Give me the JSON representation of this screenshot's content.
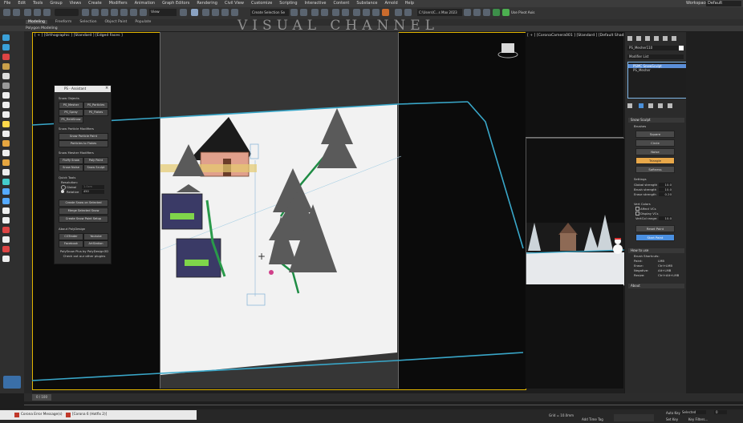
{
  "menu": [
    "File",
    "Edit",
    "Tools",
    "Group",
    "Views",
    "Create",
    "Modifiers",
    "Animation",
    "Graph Editors",
    "Rendering",
    "Civil View",
    "Customize",
    "Scripting",
    "Interactive",
    "Content",
    "Substance",
    "Arnold",
    "Help"
  ],
  "workspaces": {
    "label": "Workspaces:",
    "value": "Default"
  },
  "toolbar": {
    "view_dropdown": "View",
    "selection_set": "Create Selection Se",
    "project_path": "C:\\Users\\C...s Max 2023",
    "pivot": "Use Pivot Axis"
  },
  "ribbon_tabs": [
    "Modeling",
    "Freeform",
    "Selection",
    "Object Paint",
    "Populate"
  ],
  "subribbon": "Polygon Modeling",
  "watermark": "VISUAL CHANNEL",
  "viewports": {
    "main_label": "[ + ] [Orthographic ] [Standard ] [Edged Faces ]",
    "camera_label": "[ + ] [CoronaCamera001 ] [Standard ] [Default Shading ]"
  },
  "polysnow": {
    "title": "PS - Assistant",
    "snow_objects": "Snow Objects",
    "btn_ps_mesher": "PS_Mesher",
    "btn_ps_particles": "PS_Particles",
    "btn_ps_spray": "PS_Spray",
    "btn_ps_flakes": "PS_Flakes",
    "btn_ps_fieldsnow": "PS_FieldSnow",
    "particle_modifiers": "Snow Particle Modifiers",
    "btn_snow_particle_paint": "Snow Particle Paint",
    "btn_particles_to_flakes": "Particles to Flakes",
    "mesher_modifiers": "Snow Mesher Modifiers",
    "btn_fluffy_snow": "Fluffy Snow",
    "btn_poly_paint": "Poly Paint",
    "btn_snow_noise": "Snow Noise",
    "btn_snow_sculpt": "Snow Sculpt",
    "quick_tools": "Quick Tools",
    "resolution": "Resolution:",
    "radio_global": "Global",
    "global_value": "1.0cm",
    "radio_relative": "Relative",
    "relative_value": "450",
    "btn_create_on_selected": "Create Snow on Selected",
    "btn_merge_selected": "Merge Selected Snow",
    "btn_create_paint_setup": "Create Snow Paint Setup",
    "about": "About PolyDesign",
    "btn_cgtrader": "CGTrader",
    "btn_youtube": "Youtube",
    "btn_facebook": "Facebook",
    "btn_artstation": "ArtStation",
    "credit1": "PolySnow Plus by PolyDesign3D",
    "credit2": "Check out our other plugins"
  },
  "command_panel": {
    "object_name": "PS_Mesher110",
    "modifier_list": "Modifier List",
    "stack": [
      "PSMC SnowSculpt",
      "PS_Mesher"
    ],
    "rollout_snow_sculpt": "Snow Sculpt",
    "brushes_label": "Brushes",
    "brushes": [
      "Square",
      "Circle",
      "Noise",
      "Triangle",
      "Softness"
    ],
    "active_brush": "Triangle",
    "settings_label": "Settings",
    "global_strength": "Global strength",
    "global_strength_val": "10.0",
    "brush_strength": "Brush strength",
    "brush_strength_val": "10.0",
    "erase_strength": "Erase strength",
    "erase_strength_val": "0.20",
    "vert_colors_label": "Vert Colors",
    "affect_vcs": "Affect VCs",
    "display_vcs": "Display VCs",
    "vertcol_range": "VertCol range:",
    "vertcol_range_val": "10.0",
    "btn_reset_paint": "Reset Paint",
    "btn_start_paint": "Start Paint",
    "rollout_how_to_use": "How to use",
    "brush_shortcuts": "Brush Shortcuts:",
    "shortcuts": [
      [
        "Paint:",
        "LMB"
      ],
      [
        "Erase:",
        "Ctrl+LMB"
      ],
      [
        "Negative:",
        "Alt+LMB"
      ],
      [
        "Resize:",
        "Ctrl+Alt+LMB"
      ]
    ],
    "rollout_about": "About"
  },
  "timeline": {
    "frame": "0 / 100"
  },
  "status": {
    "taskbar_item1": "Corona Error Message(s)",
    "taskbar_item2": "[Corona 6 (Hotfix 2)]",
    "grid": "Grid = 10.0mm",
    "add_time_tag": "Add Time Tag",
    "auto_key": "Auto Key",
    "selected": "Selected",
    "set_key": "Set Key",
    "key_filters": "Key Filters...",
    "frame_field": "0"
  }
}
